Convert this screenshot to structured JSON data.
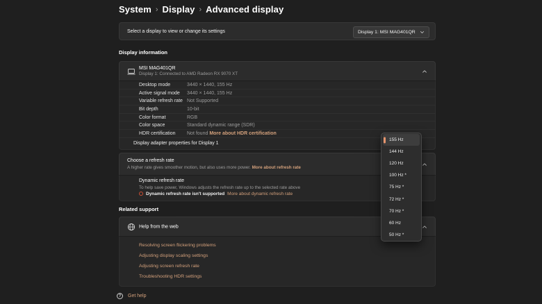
{
  "breadcrumb": {
    "items": [
      "System",
      "Display",
      "Advanced display"
    ],
    "separator": "›"
  },
  "colors": {
    "accent_link": "#d4a17c",
    "selection_bar": "#e8956d",
    "warning": "#cf4e33"
  },
  "display_selector": {
    "label": "Select a display to view or change its settings",
    "value": "Display 1: MSI MAG401QR"
  },
  "display_information": {
    "section_label": "Display information",
    "device_name": "MSI MAG401QR",
    "device_subtitle": "Display 1: Connected to AMD Radeon RX 9070 XT",
    "rows": [
      {
        "label": "Desktop mode",
        "value": "3440 × 1440, 155 Hz"
      },
      {
        "label": "Active signal mode",
        "value": "3440 × 1440, 155 Hz"
      },
      {
        "label": "Variable refresh rate",
        "value": "Not Supported"
      },
      {
        "label": "Bit depth",
        "value": "10-bit"
      },
      {
        "label": "Color format",
        "value": "RGB"
      },
      {
        "label": "Color space",
        "value": "Standard dynamic range (SDR)"
      },
      {
        "label": "HDR certification",
        "value": "Not found",
        "link": "More about HDR certification"
      }
    ],
    "adapter_properties_link": "Display adapter properties for Display 1"
  },
  "refresh_rate": {
    "title": "Choose a refresh rate",
    "subtitle": "A higher rate gives smoother motion, but also uses more power.",
    "learn_more": "More about refresh rate",
    "dropdown": {
      "selected": "155 Hz",
      "options": [
        "155 Hz",
        "144 Hz",
        "120 Hz",
        "100 Hz *",
        "75 Hz *",
        "72 Hz *",
        "70 Hz *",
        "60 Hz",
        "50 Hz *"
      ]
    }
  },
  "dynamic_refresh_rate": {
    "title": "Dynamic refresh rate",
    "subtitle": "To help save power, Windows adjusts the refresh rate up to the selected rate above",
    "status": "Dynamic refresh rate isn't supported",
    "learn_more": "More about dynamic refresh rate"
  },
  "related_support": {
    "section_label": "Related support",
    "title": "Help from the web",
    "links": [
      "Resolving screen flickering problems",
      "Adjusting display scaling settings",
      "Adjusting screen refresh rate",
      "Troubleshooting HDR settings"
    ]
  },
  "footer": {
    "get_help": "Get help"
  }
}
